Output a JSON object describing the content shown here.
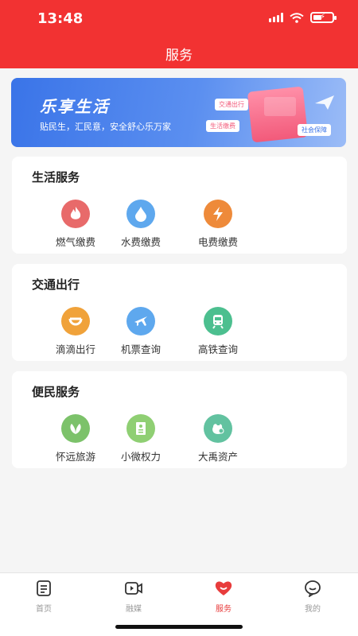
{
  "status_bar": {
    "time": "13:48"
  },
  "header": {
    "title": "服务"
  },
  "banner": {
    "headline": "乐享生活",
    "subline": "贴民生，汇民意，安全舒心乐万家",
    "tags": [
      "交通出行",
      "生活缴费",
      "社会保障"
    ]
  },
  "sections": [
    {
      "title": "生活服务",
      "items": [
        {
          "label": "燃气缴费",
          "icon": "flame-icon",
          "color": "#e86a6a"
        },
        {
          "label": "水费缴费",
          "icon": "water-drop-icon",
          "color": "#5ea8ee"
        },
        {
          "label": "电费缴费",
          "icon": "lightning-icon",
          "color": "#ee8a3a"
        }
      ]
    },
    {
      "title": "交通出行",
      "items": [
        {
          "label": "滴滴出行",
          "icon": "didi-icon",
          "color": "#f0a23a"
        },
        {
          "label": "机票查询",
          "icon": "airplane-icon",
          "color": "#5ea8ee"
        },
        {
          "label": "高铁查询",
          "icon": "train-icon",
          "color": "#4cbf8f"
        }
      ]
    },
    {
      "title": "便民服务",
      "items": [
        {
          "label": "怀远旅游",
          "icon": "leaf-icon",
          "color": "#7cc26a"
        },
        {
          "label": "小微权力",
          "icon": "document-icon",
          "color": "#8fcf73"
        },
        {
          "label": "大禹资产",
          "icon": "money-bag-icon",
          "color": "#62c2a0"
        }
      ]
    }
  ],
  "tabbar": {
    "tabs": [
      {
        "label": "首页",
        "icon": "home-doc-icon",
        "active": false
      },
      {
        "label": "融媒",
        "icon": "video-icon",
        "active": false
      },
      {
        "label": "服务",
        "icon": "heart-icon",
        "active": true
      },
      {
        "label": "我的",
        "icon": "profile-icon",
        "active": false
      }
    ],
    "active_color": "#e83c3c",
    "inactive_color": "#999999"
  },
  "colors": {
    "header_bg": "#f23232",
    "page_bg": "#f5f5f5",
    "banner_blue": "#3a74e8"
  }
}
